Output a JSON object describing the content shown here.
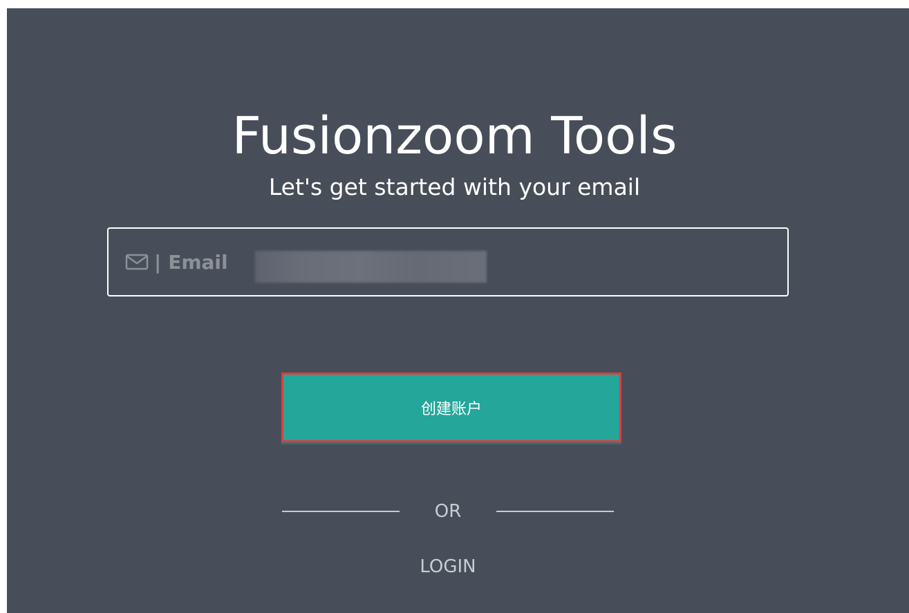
{
  "header": {
    "title": "Fusionzoom Tools",
    "subtitle": "Let's get started with your email"
  },
  "email": {
    "separator": "|",
    "label": "Email",
    "icon": "mail-icon",
    "value": ""
  },
  "actions": {
    "create_account_label": "创建账户",
    "or_label": "OR",
    "login_label": "LOGIN"
  },
  "colors": {
    "background": "#484e59",
    "primary_button": "#25a69a",
    "highlight_border": "#e23b3b",
    "text": "#ffffff",
    "muted_text": "#c8ccd2"
  }
}
